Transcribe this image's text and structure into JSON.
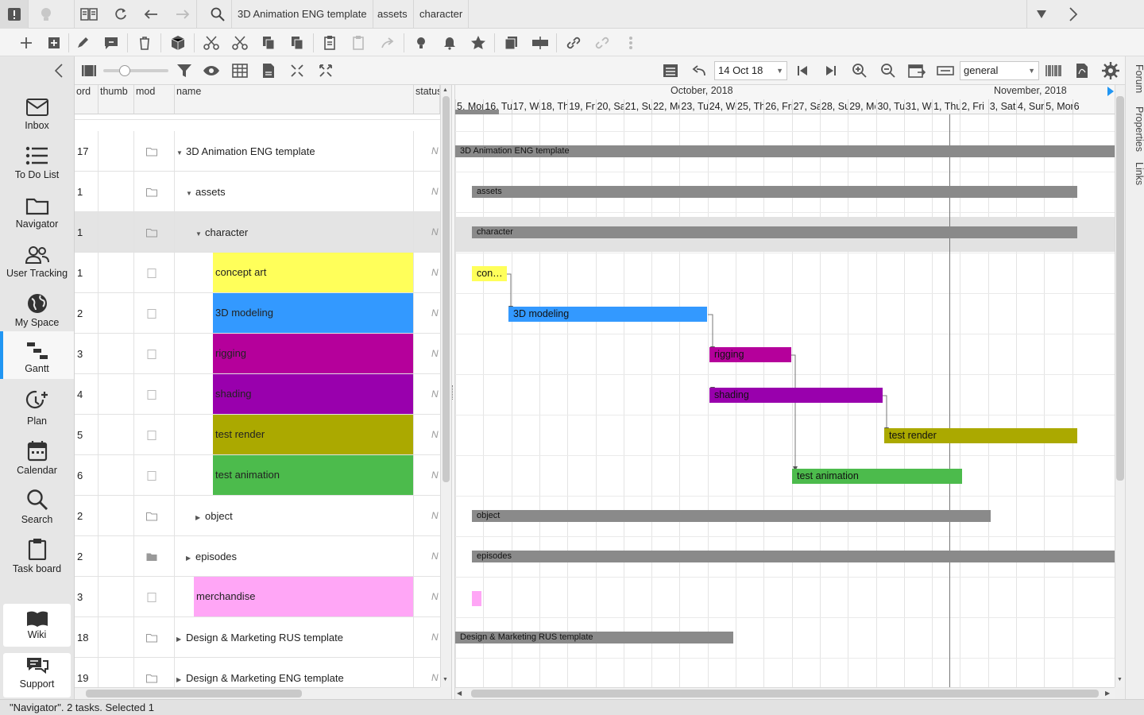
{
  "breadcrumbs": [
    "3D Animation ENG template",
    "assets",
    "character"
  ],
  "sidebar": {
    "items": [
      {
        "label": "Inbox",
        "icon": "inbox-icon"
      },
      {
        "label": "To Do List",
        "icon": "list-icon"
      },
      {
        "label": "Navigator",
        "icon": "folder-icon"
      },
      {
        "label": "User Tracking",
        "icon": "users-icon"
      },
      {
        "label": "My Space",
        "icon": "globe-icon"
      },
      {
        "label": "Gantt",
        "icon": "gantt-icon"
      },
      {
        "label": "Plan",
        "icon": "plan-icon"
      },
      {
        "label": "Calendar",
        "icon": "calendar-icon"
      },
      {
        "label": "Search",
        "icon": "search-icon"
      },
      {
        "label": "Task board",
        "icon": "clipboard-icon"
      }
    ],
    "wiki": "Wiki",
    "support": "Support"
  },
  "subbar": {
    "date_value": "14 Oct 18",
    "view_value": "general"
  },
  "right_tabs": [
    "Forum",
    "Properties",
    "Links"
  ],
  "grid": {
    "columns": [
      "ord",
      "thumb",
      "mod",
      "name",
      "status"
    ],
    "rows": [
      {
        "ord": "17",
        "name": "3D Animation ENG template",
        "indent": 0,
        "toggle": "▼",
        "folder": "folder-outline",
        "color": "",
        "status": "N"
      },
      {
        "ord": "1",
        "name": "assets",
        "indent": 1,
        "toggle": "▼",
        "folder": "folder-outline",
        "color": "",
        "status": "N"
      },
      {
        "ord": "1",
        "name": "character",
        "indent": 2,
        "toggle": "▼",
        "folder": "folder-outline",
        "color": "",
        "status": "N",
        "selected": true
      },
      {
        "ord": "1",
        "name": "concept art",
        "indent": 3,
        "toggle": "",
        "folder": "task",
        "color": "#ffff5a",
        "status": "N"
      },
      {
        "ord": "2",
        "name": "3D modeling",
        "indent": 3,
        "toggle": "",
        "folder": "task",
        "color": "#3399ff",
        "status": "N"
      },
      {
        "ord": "3",
        "name": "rigging",
        "indent": 3,
        "toggle": "",
        "folder": "task",
        "color": "#b5009b",
        "status": "N"
      },
      {
        "ord": "4",
        "name": "shading",
        "indent": 3,
        "toggle": "",
        "folder": "task",
        "color": "#9900ad",
        "status": "N"
      },
      {
        "ord": "5",
        "name": "test render",
        "indent": 3,
        "toggle": "",
        "folder": "task",
        "color": "#aba900",
        "status": "N"
      },
      {
        "ord": "6",
        "name": "test animation",
        "indent": 3,
        "toggle": "",
        "folder": "task",
        "color": "#4cbb4c",
        "status": "N"
      },
      {
        "ord": "2",
        "name": "object",
        "indent": 2,
        "toggle": "▶",
        "folder": "folder-outline",
        "color": "",
        "status": "N"
      },
      {
        "ord": "2",
        "name": "episodes",
        "indent": 1,
        "toggle": "▶",
        "folder": "folder-filled",
        "color": "",
        "status": "N"
      },
      {
        "ord": "3",
        "name": "merchandise",
        "indent": 1,
        "toggle": "",
        "folder": "task",
        "color": "#ffa6f6",
        "status": "N"
      },
      {
        "ord": "18",
        "name": "Design & Marketing RUS template",
        "indent": 0,
        "toggle": "▶",
        "folder": "folder-outline",
        "color": "",
        "status": "N"
      },
      {
        "ord": "19",
        "name": "Design & Marketing ENG template",
        "indent": 0,
        "toggle": "▶",
        "folder": "folder-outline",
        "color": "",
        "status": "N"
      }
    ]
  },
  "gantt": {
    "months": [
      "October, 2018",
      "November, 2018"
    ],
    "days": [
      "5, Mon",
      "16, Tue",
      "17, Wed",
      "18, Thu",
      "19, Fri",
      "20, Sat",
      "21, Sun",
      "22, Mon",
      "23, Tue",
      "24, Wed",
      "25, Thu",
      "26, Fri",
      "27, Sat",
      "28, Sun",
      "29, Mon",
      "30, Tue",
      "31, Wed",
      "1, Thu",
      "2, Fri",
      "3, Sat",
      "4, Sun",
      "5, Mon",
      "6"
    ],
    "bars": [
      {
        "label": "3D Animation ENG template",
        "color": "#8a8a8a",
        "summary": true
      },
      {
        "label": "assets",
        "color": "#8a8a8a",
        "summary": true
      },
      {
        "label": "character",
        "color": "#8a8a8a",
        "summary": true
      },
      {
        "label": "con…",
        "color": "#ffff5a",
        "summary": false
      },
      {
        "label": "3D modeling",
        "color": "#3399ff",
        "summary": false
      },
      {
        "label": "rigging",
        "color": "#b5009b",
        "summary": false
      },
      {
        "label": "shading",
        "color": "#9900ad",
        "summary": false
      },
      {
        "label": "test render",
        "color": "#aba900",
        "summary": false
      },
      {
        "label": "test animation",
        "color": "#4cbb4c",
        "summary": false
      },
      {
        "label": "object",
        "color": "#8a8a8a",
        "summary": true
      },
      {
        "label": "episodes",
        "color": "#8a8a8a",
        "summary": true
      },
      {
        "label": "",
        "color": "#ffa6f6",
        "summary": false
      },
      {
        "label": "Design & Marketing RUS template",
        "color": "#8a8a8a",
        "summary": true
      },
      {
        "label": "",
        "color": "#8a8a8a",
        "summary": true
      }
    ]
  },
  "status_text": "\"Navigator\". 2 tasks. Selected 1"
}
